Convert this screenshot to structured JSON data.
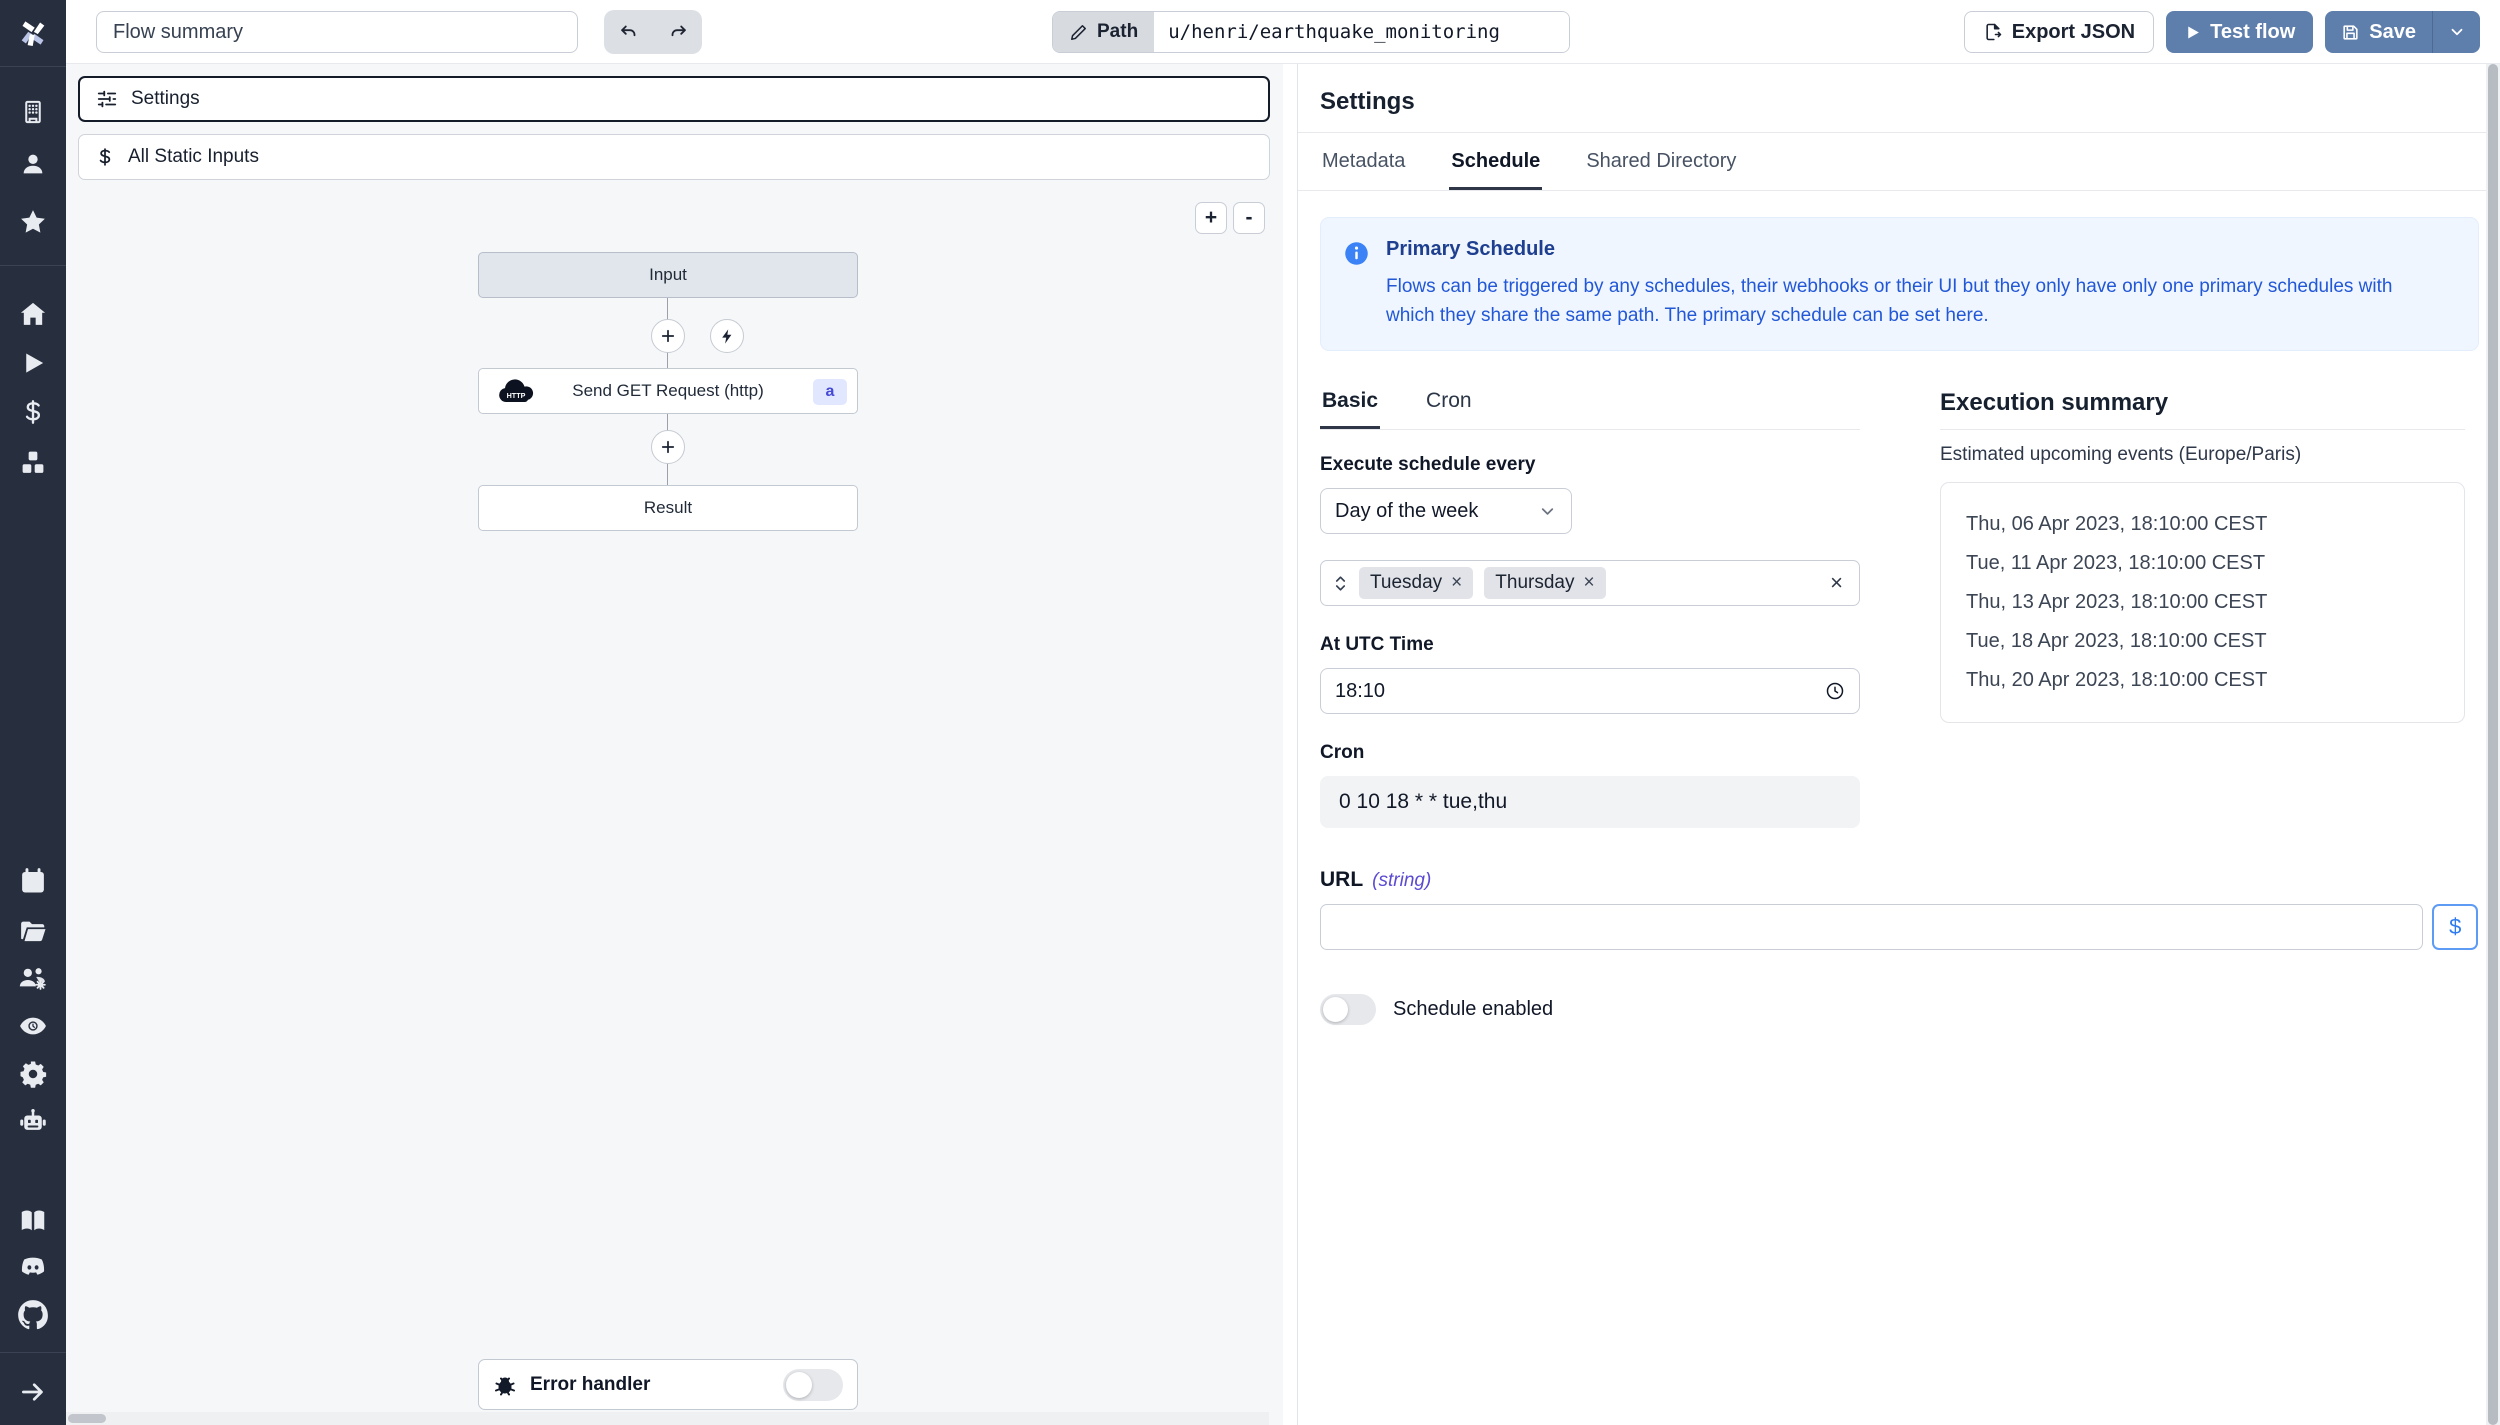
{
  "topbar": {
    "flow_summary_placeholder": "Flow summary",
    "path_label": "Path",
    "path_value": "u/henri/earthquake_monitoring",
    "export_json": "Export JSON",
    "test_flow": "Test flow",
    "save": "Save"
  },
  "sidebar": {
    "icons": [
      "windmill-logo",
      "workspace-building",
      "user",
      "favorites-star",
      "home",
      "runs-play",
      "variables-dollar",
      "resources-cubes",
      "schedules-calendar",
      "folders",
      "groups-gear",
      "audit-logs-eye",
      "settings-gear",
      "workers-robot",
      "docs-book",
      "discord",
      "github",
      "collapse-arrow"
    ]
  },
  "canvas": {
    "settings_label": "Settings",
    "static_inputs_label": "All Static Inputs",
    "zoom_in": "+",
    "zoom_out": "-",
    "nodes": {
      "input": "Input",
      "http": "Send GET Request (http)",
      "http_badge": "a",
      "result": "Result"
    },
    "error_handler": "Error handler"
  },
  "panel": {
    "title": "Settings",
    "tabs": [
      "Metadata",
      "Schedule",
      "Shared Directory"
    ],
    "active_tab": "Schedule",
    "alert": {
      "title": "Primary Schedule",
      "body": "Flows can be triggered by any schedules, their webhooks or their UI but they only have only one primary schedules with which they share the same path. The primary schedule can be set here."
    },
    "schedule_tabs": [
      "Basic",
      "Cron"
    ],
    "form": {
      "execute_label": "Execute schedule every",
      "frequency_value": "Day of the week",
      "tags": [
        "Tuesday",
        "Thursday"
      ],
      "remove_symbol": "×",
      "clear_symbol": "×",
      "utc_label": "At UTC Time",
      "time_value": "18:10",
      "cron_label": "Cron",
      "cron_value": "0 10 18 * * tue,thu"
    },
    "summary": {
      "title": "Execution summary",
      "subtitle": "Estimated upcoming events (Europe/Paris)",
      "events": [
        "Thu, 06 Apr 2023, 18:10:00 CEST",
        "Tue, 11 Apr 2023, 18:10:00 CEST",
        "Thu, 13 Apr 2023, 18:10:00 CEST",
        "Tue, 18 Apr 2023, 18:10:00 CEST",
        "Thu, 20 Apr 2023, 18:10:00 CEST"
      ]
    },
    "url": {
      "label": "URL",
      "type": "(string)",
      "dollar": "$"
    },
    "schedule_enabled_label": "Schedule enabled"
  },
  "colors": {
    "sidebar_bg": "#272e3e",
    "button_blue": "#5e7eac",
    "alert_bg": "#eff6ff",
    "alert_title": "#1e3f8f",
    "alert_body": "#2257d6",
    "badge_bg": "#e0e7ff",
    "badge_text": "#4649d6",
    "canvas_bg": "#f5f7f9"
  }
}
